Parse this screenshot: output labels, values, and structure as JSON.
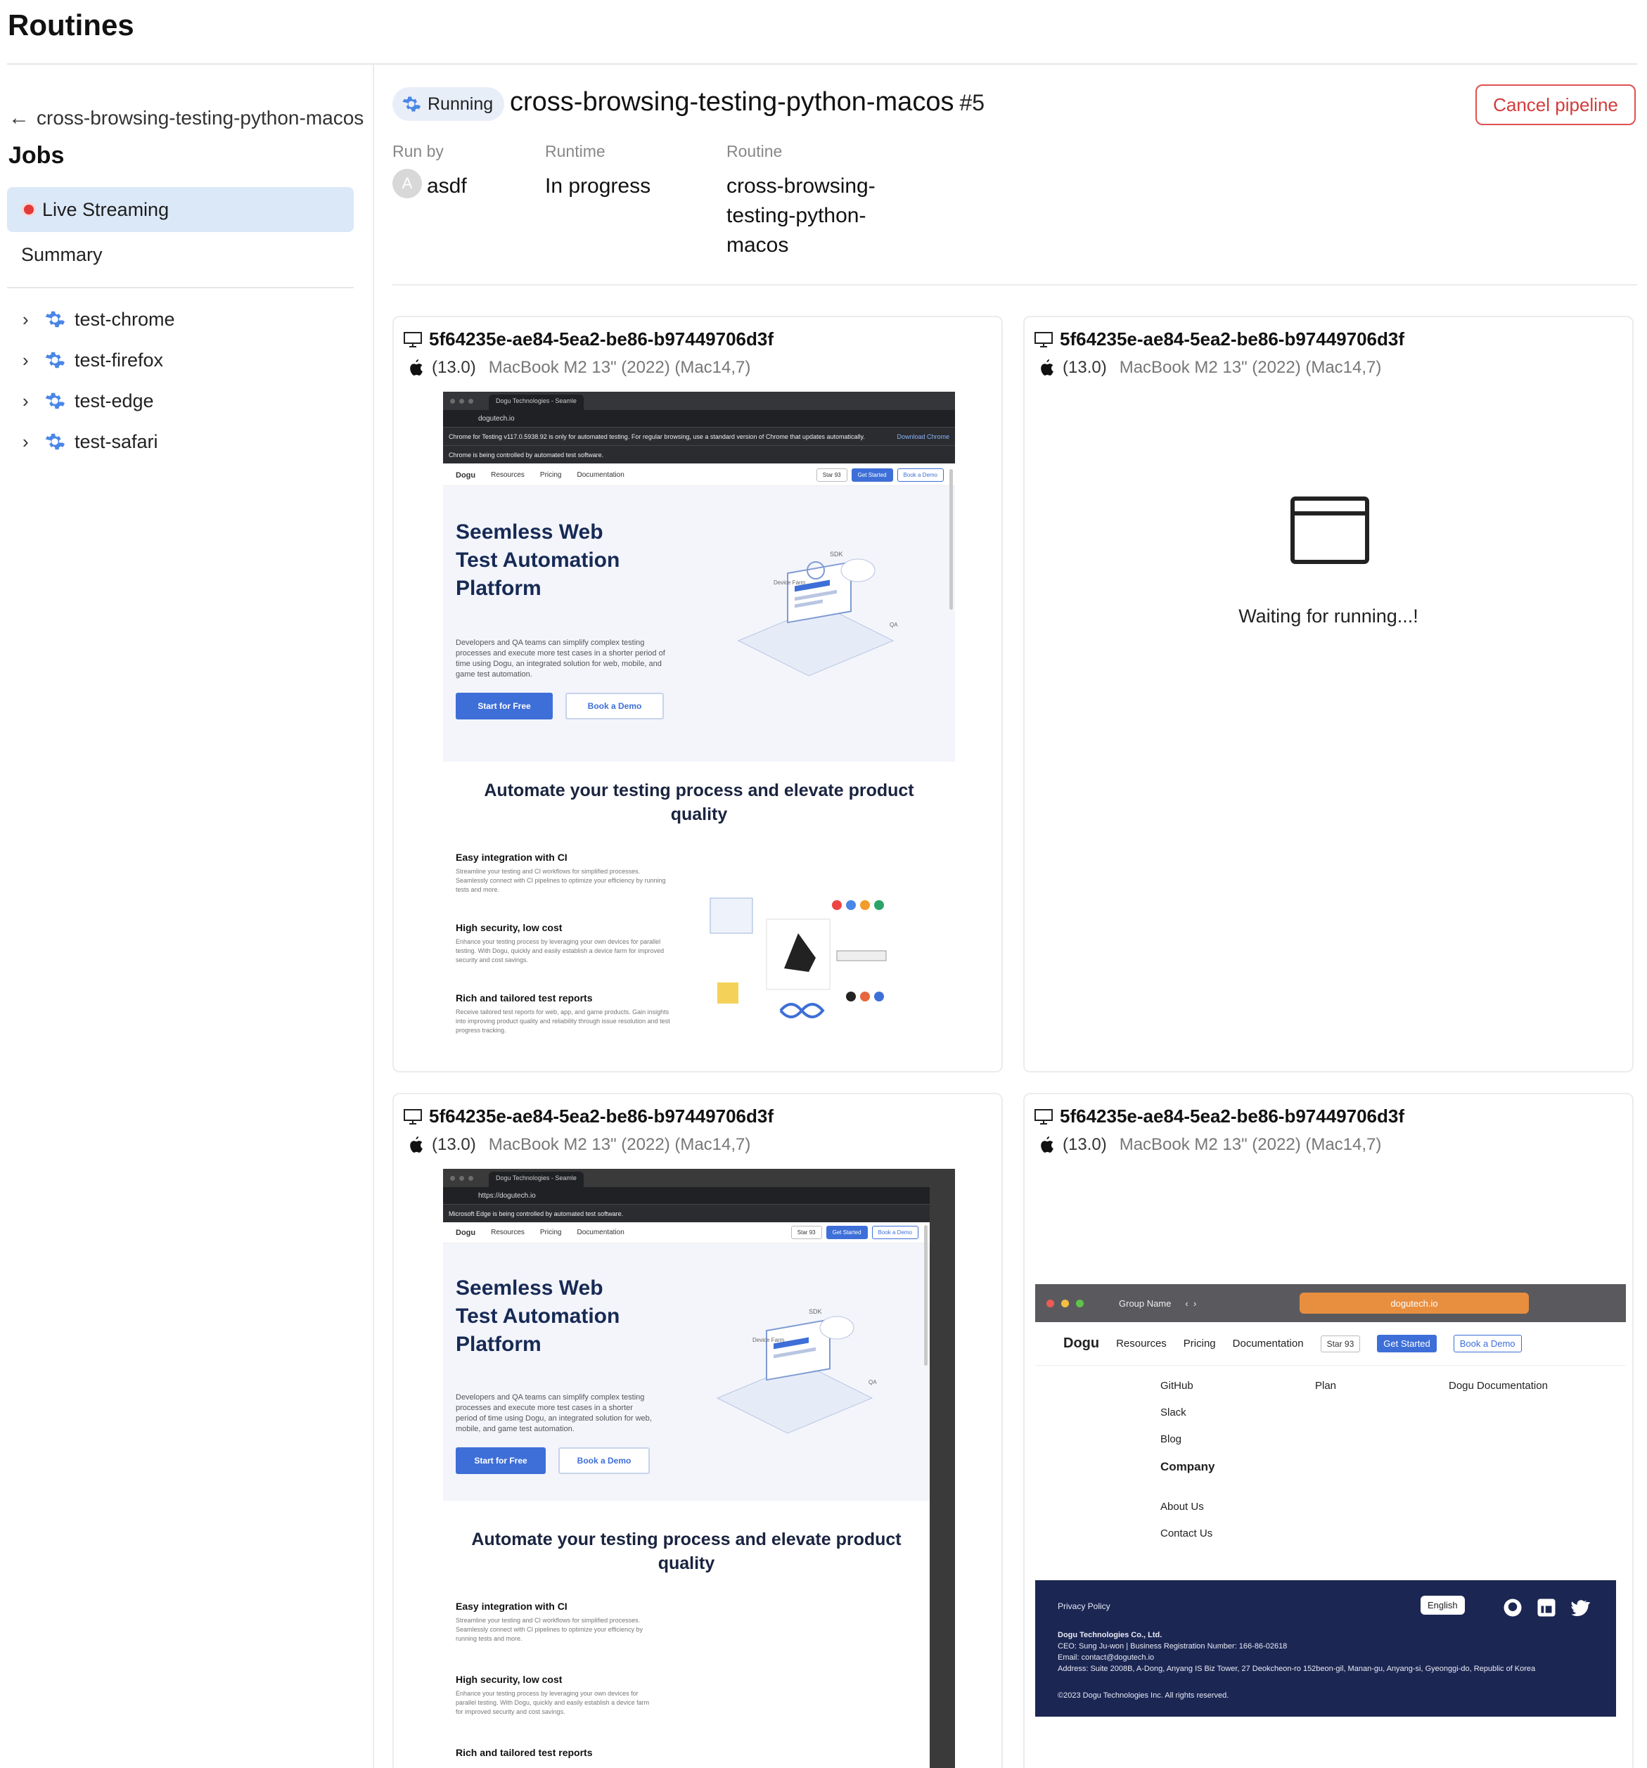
{
  "page": {
    "title": "Routines"
  },
  "sidebar": {
    "back_label": "cross-browsing-testing-python-macos",
    "jobs_heading": "Jobs",
    "live_label": "Live Streaming",
    "summary_label": "Summary",
    "jobs": [
      {
        "label": "test-chrome"
      },
      {
        "label": "test-firefox"
      },
      {
        "label": "test-edge"
      },
      {
        "label": "test-safari"
      }
    ]
  },
  "header": {
    "status": "Running",
    "pipeline_name": "cross-browsing-testing-python-macos",
    "pipeline_number": "#5",
    "cancel_label": "Cancel pipeline",
    "run_by_label": "Run by",
    "run_by_initial": "A",
    "run_by_value": "asdf",
    "runtime_label": "Runtime",
    "runtime_value": "In progress",
    "routine_label": "Routine",
    "routine_value": "cross-browsing-testing-python-macos"
  },
  "devices": [
    {
      "id": "5f64235e-ae84-5ea2-be86-b97449706d3f",
      "os_version": "(13.0)",
      "model": "MacBook M2 13\" (2022) (Mac14,7)"
    },
    {
      "id": "5f64235e-ae84-5ea2-be86-b97449706d3f",
      "os_version": "(13.0)",
      "model": "MacBook M2 13\" (2022) (Mac14,7)",
      "waiting_text": "Waiting for running...!"
    },
    {
      "id": "5f64235e-ae84-5ea2-be86-b97449706d3f",
      "os_version": "(13.0)",
      "model": "MacBook M2 13\" (2022) (Mac14,7)"
    },
    {
      "id": "5f64235e-ae84-5ea2-be86-b97449706d3f",
      "os_version": "(13.0)",
      "model": "MacBook M2 13\" (2022) (Mac14,7)"
    }
  ],
  "site": {
    "tab_title": "Dogu Technologies - Seamle",
    "url": "dogutech.io",
    "url_full": "https://dogutech.io",
    "chrome_notice": "Chrome for Testing v117.0.5938.92 is only for automated testing. For regular browsing, use a standard version of Chrome that updates automatically.",
    "chrome_download": "Download Chrome",
    "chrome_controlled": "Chrome is being controlled by automated test software.",
    "edge_controlled": "Microsoft Edge is being controlled by automated test software.",
    "logo": "Dogu",
    "nav": [
      "Resources",
      "Pricing",
      "Documentation"
    ],
    "star_label": "Star",
    "star_count": "93",
    "get_started": "Get Started",
    "book_demo": "Book a Demo",
    "hero_title": "Seemless Web Test Automation Platform",
    "hero_desc": "Developers and QA teams can simplify complex testing processes and execute more test cases in a shorter period of time using Dogu, an integrated solution for web, mobile, and game test automation.",
    "start_free": "Start for Free",
    "section_title": "Automate your testing process and elevate product quality",
    "features": [
      {
        "title": "Easy integration with CI",
        "desc": "Streamline your testing and CI workflows for simplified processes. Seamlessly connect with CI pipelines to optimize your efficiency by running tests and more."
      },
      {
        "title": "High security, low cost",
        "desc": "Enhance your testing process by leveraging your own devices for parallel testing. With Dogu, quickly and easily establish a device farm for improved security and cost savings."
      },
      {
        "title": "Rich and tailored test reports",
        "desc": "Receive tailored test reports for web, app, and game products. Gain insights into improving product quality and reliability through issue resolution and test progress tracking."
      }
    ],
    "art_labels": [
      "SDK",
      "Device Farm",
      "QA"
    ]
  },
  "safari": {
    "group_name": "Group Name",
    "footer_col1": [
      "GitHub",
      "Slack",
      "Blog"
    ],
    "footer_col2": [
      "Plan"
    ],
    "footer_col3": [
      "Dogu Documentation"
    ],
    "company_heading": "Company",
    "company_links": [
      "About Us",
      "Contact Us"
    ],
    "privacy": "Privacy Policy",
    "corp_name": "Dogu Technologies Co., Ltd.",
    "ceo_line": "CEO: Sung Ju-won | Business Registration Number: 166-86-02618",
    "email_line": "Email: contact@dogutech.io",
    "address_line": "Address: Suite 2008B, A-Dong, Anyang IS Biz Tower, 27 Deokcheon-ro 152beon-gil, Manan-gu, Anyang-si, Gyeonggi-do, Republic of Korea",
    "copyright": "©2023 Dogu Technologies Inc. All rights reserved.",
    "language": "English"
  },
  "colors": {
    "accent": "#3e6fd8",
    "danger": "#d43b3b",
    "nav_active_bg": "#dbe8f8",
    "footer_bg": "#1c2653"
  },
  "icons": [
    "back-arrow-icon",
    "record-dot-icon",
    "chevron-right-icon",
    "gear-icon",
    "monitor-icon",
    "apple-icon",
    "browser-window-icon"
  ]
}
